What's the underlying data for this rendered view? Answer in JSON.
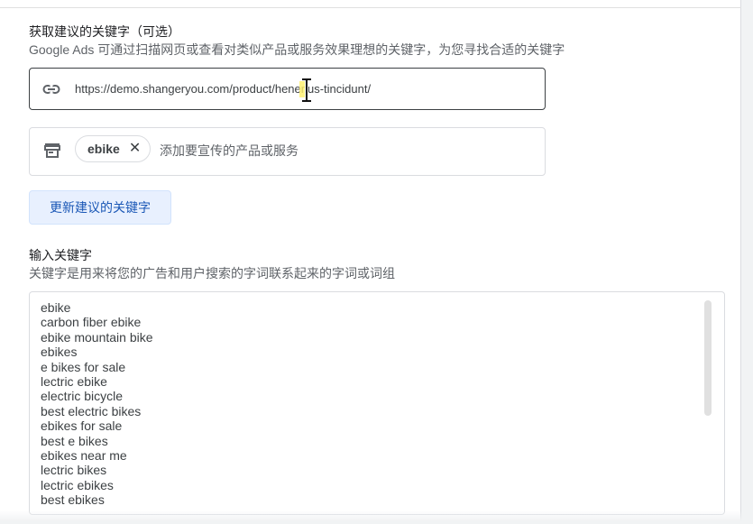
{
  "suggest": {
    "title": "获取建议的关键字（可选）",
    "description": "Google Ads 可通过扫描网页或查看对类似产品或服务效果理想的关键字，为您寻找合适的关键字",
    "url_value": "https://demo.shangeryou.com/product/henerius-tincidunt/",
    "link_icon": "link-icon",
    "store_icon": "storefront-icon",
    "product_chip": "ebike",
    "product_chip_close": "✕",
    "product_placeholder": "添加要宣传的产品或服务",
    "refresh_button": "更新建议的关键字"
  },
  "keywords": {
    "title": "输入关键字",
    "description": "关键字是用来将您的广告和用户搜索的字词联系起来的字词或词组",
    "items": [
      "ebike",
      "carbon fiber ebike",
      "ebike mountain bike",
      "ebikes",
      "e bikes for sale",
      "lectric ebike",
      "electric bicycle",
      "best electric bikes",
      "ebikes for sale",
      "best e bikes",
      "ebikes near me",
      "lectric bikes",
      "lectric ebikes",
      "best ebikes"
    ]
  },
  "colors": {
    "accent_text": "#1a57b6",
    "button_bg": "#e8f0fe"
  }
}
